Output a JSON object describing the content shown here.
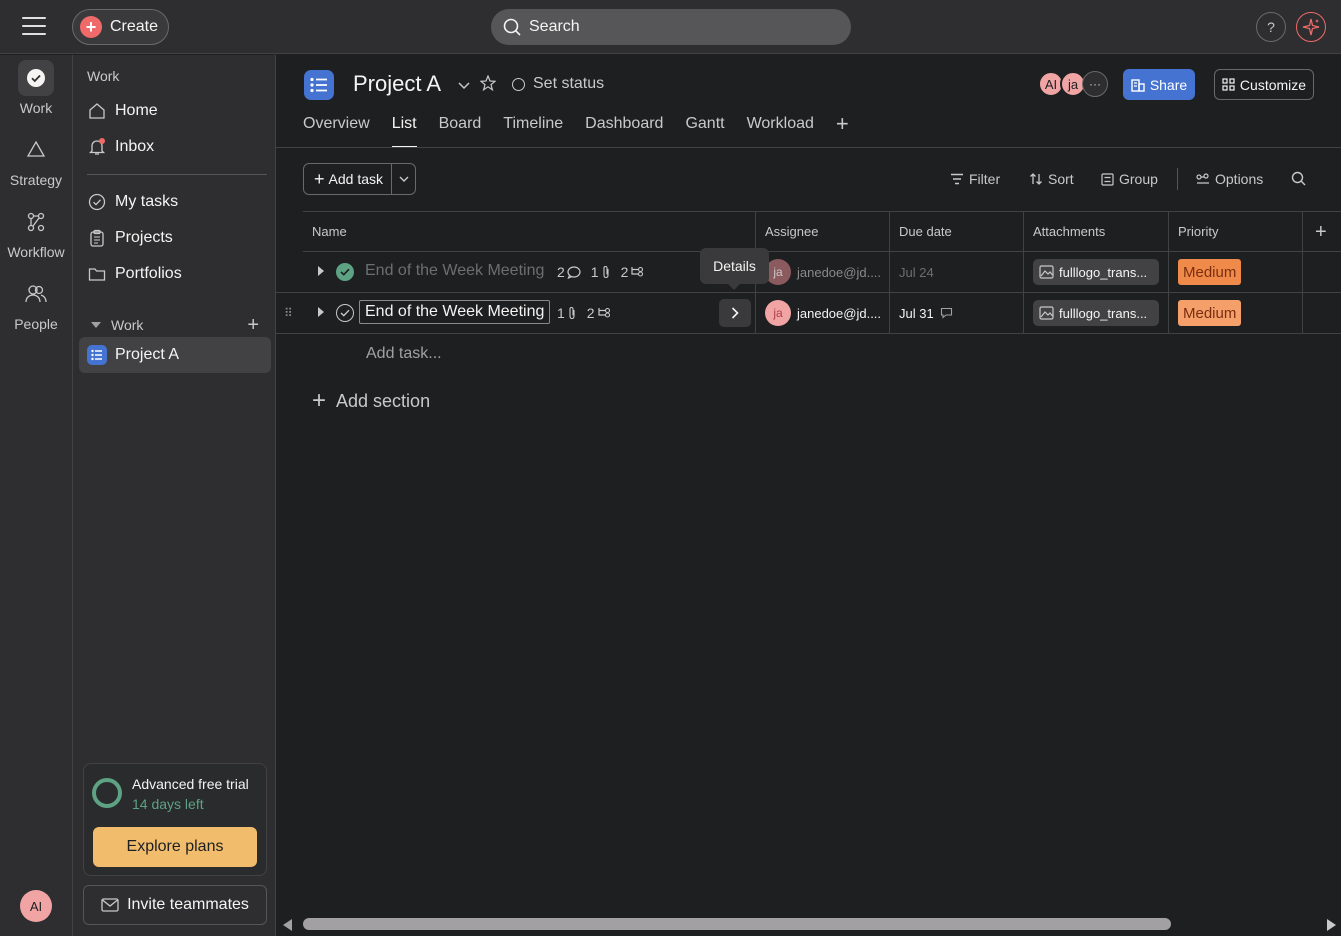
{
  "topbar": {
    "create_label": "Create",
    "search_placeholder": "Search",
    "help_label": "?"
  },
  "rail": {
    "items": [
      {
        "label": "Work",
        "icon": "check-circle-icon"
      },
      {
        "label": "Strategy",
        "icon": "triangle-icon"
      },
      {
        "label": "Workflow",
        "icon": "workflow-icon"
      },
      {
        "label": "People",
        "icon": "people-icon"
      }
    ],
    "avatar": "AI"
  },
  "sidebar": {
    "heading": "Work",
    "items": [
      {
        "label": "Home",
        "icon": "home-icon"
      },
      {
        "label": "Inbox",
        "icon": "bell-icon"
      },
      {
        "label": "My tasks",
        "icon": "check-circle-icon"
      },
      {
        "label": "Projects",
        "icon": "clipboard-icon"
      },
      {
        "label": "Portfolios",
        "icon": "folder-icon"
      }
    ],
    "section_label": "Work",
    "project_label": "Project A",
    "trial": {
      "title": "Advanced free trial",
      "subtitle": "14 days left",
      "cta": "Explore plans"
    },
    "invite_label": "Invite teammates"
  },
  "project": {
    "title": "Project A",
    "set_status": "Set status",
    "members": [
      "AI",
      "ja"
    ],
    "share_label": "Share",
    "customize_label": "Customize",
    "tabs": [
      "Overview",
      "List",
      "Board",
      "Timeline",
      "Dashboard",
      "Gantt",
      "Workload"
    ],
    "active_tab": "List"
  },
  "toolbar": {
    "add_task": "Add task",
    "filter": "Filter",
    "sort": "Sort",
    "group": "Group",
    "options": "Options"
  },
  "table": {
    "columns": [
      "Name",
      "Assignee",
      "Due date",
      "Attachments",
      "Priority"
    ],
    "rows": [
      {
        "name": "End of the Week Meeting",
        "completed": true,
        "comments": "2",
        "attachments_count": "1",
        "subtasks": "2",
        "assignee_initials": "ja",
        "assignee": "janedoe@jd....",
        "due": "Jul 24",
        "attachment": "fulllogo_trans...",
        "priority": "Medium"
      },
      {
        "name": "End of the Week Meeting",
        "completed": false,
        "attachments_count": "1",
        "subtasks": "2",
        "assignee_initials": "ja",
        "assignee": "janedoe@jd....",
        "due": "Jul 31",
        "attachment": "fulllogo_trans...",
        "priority": "Medium"
      }
    ],
    "tooltip": "Details",
    "add_task_placeholder": "Add task...",
    "add_section": "Add section"
  },
  "colors": {
    "accent_blue": "#4573d2",
    "create_red": "#f06a6a",
    "done_green": "#5da283",
    "priority_orange": "#f5a06a",
    "trial_cta": "#f1bd6c"
  }
}
